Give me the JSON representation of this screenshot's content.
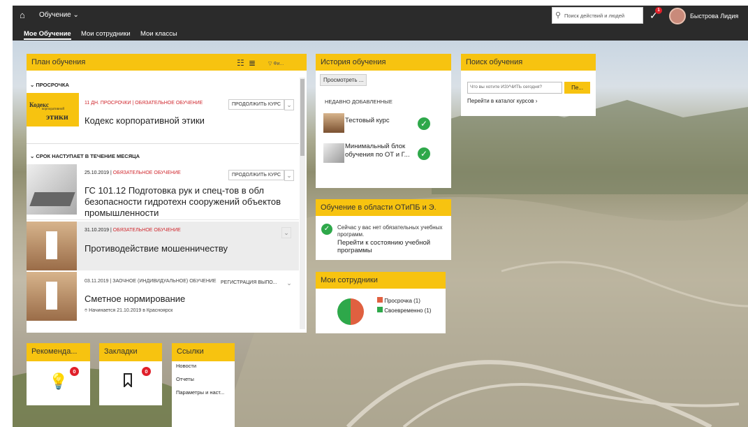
{
  "header": {
    "app_menu": "Обучение",
    "search_placeholder": "Поиск действий и людей",
    "user_name": "Быстрова Лидия",
    "notification_count": "1"
  },
  "nav": {
    "tabs": [
      "Мое Обучение",
      "Мои сотрудники",
      "Мои классы"
    ]
  },
  "plan": {
    "title": "План обучения",
    "filter_label": "Фи...",
    "sections": {
      "overdue": "ПРОСРОЧКА",
      "due_month": "СРОК НАСТУПАЕТ В ТЕЧЕНИЕ МЕСЯЦА"
    },
    "items": [
      {
        "meta_a": "11 ДН. ПРОСРОЧКИ",
        "meta_b": "ОБЯЗАТЕЛЬНОЕ ОБУЧЕНИЕ",
        "title": "Кодекс корпоративной этики",
        "action": "ПРОДОЛЖИТЬ КУРС",
        "thumb_text": [
          "Кодекс",
          "корпоративной",
          "этики"
        ]
      },
      {
        "meta_a": "25.10.2019",
        "meta_b": "ОБЯЗАТЕЛЬНОЕ ОБУЧЕНИЕ",
        "title": "ГС 101.12 Подготовка рук и спец-тов в обл безопасности гидротехн сооружений объектов промышленности",
        "action": "ПРОДОЛЖИТЬ КУРС"
      },
      {
        "meta_a": "31.10.2019",
        "meta_b": "ОБЯЗАТЕЛЬНОЕ ОБУЧЕНИЕ",
        "title": "Противодействие мошенничеству"
      },
      {
        "meta_a": "03.11.2019",
        "meta_b": "ЗАОЧНОЕ (ИНДИВИДУАЛЬНОЕ) ОБУЧЕНИЕ",
        "title": "Сметное нормирование",
        "action": "РЕГИСТРАЦИЯ ВЫПО...",
        "location": "Начинается 21.10.2019 в Красноярск"
      }
    ]
  },
  "history": {
    "title": "История обучения",
    "view_button": "Просмотреть ...",
    "recent_label": "НЕДАВНО ДОБАВЛЕННЫЕ",
    "items": [
      "Тестовый курс",
      "Минимальный блок обучения по ОТ и Г..."
    ]
  },
  "search": {
    "title": "Поиск обучения",
    "placeholder": "Что вы хотите ИЗУЧИТЬ сегодня?",
    "go_button": "Пе...",
    "catalog_link": "Перейти в каталог курсов"
  },
  "ot": {
    "title": "Обучение в области ОТиПБ и Э.",
    "message": "Сейчас у вас нет обязательных учебных программ.",
    "link": "Перейти к состоянию учебной программы"
  },
  "team": {
    "title": "Мои сотрудники",
    "legend": [
      "Просрочка (1)",
      "Своевременно (1)"
    ],
    "colors": [
      "#e06040",
      "#2ea84a"
    ],
    "chart_data": {
      "type": "pie",
      "categories": [
        "Просрочка",
        "Своевременно"
      ],
      "values": [
        1,
        1
      ],
      "colors": [
        "#e06040",
        "#2ea84a"
      ]
    }
  },
  "recommend": {
    "title": "Рекоменда...",
    "count": "0"
  },
  "bookmarks": {
    "title": "Закладки",
    "count": "0"
  },
  "links": {
    "title": "Ссылки",
    "items": [
      "Новости",
      "Отчеты",
      "Параметры и наст..."
    ]
  }
}
